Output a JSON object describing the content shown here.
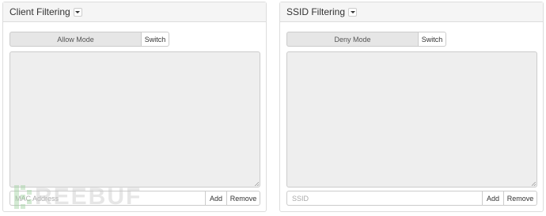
{
  "client_panel": {
    "title": "Client Filtering",
    "mode": "Allow Mode",
    "switch_label": "Switch",
    "input_placeholder": "MAC Address",
    "add_label": "Add",
    "remove_label": "Remove"
  },
  "ssid_panel": {
    "title": "SSID Filtering",
    "mode": "Deny Mode",
    "switch_label": "Switch",
    "input_placeholder": "SSID",
    "add_label": "Add",
    "remove_label": "Remove"
  },
  "watermark": {
    "text": "REEBUF"
  },
  "icons": {
    "dropdown": "caret-down-icon"
  }
}
